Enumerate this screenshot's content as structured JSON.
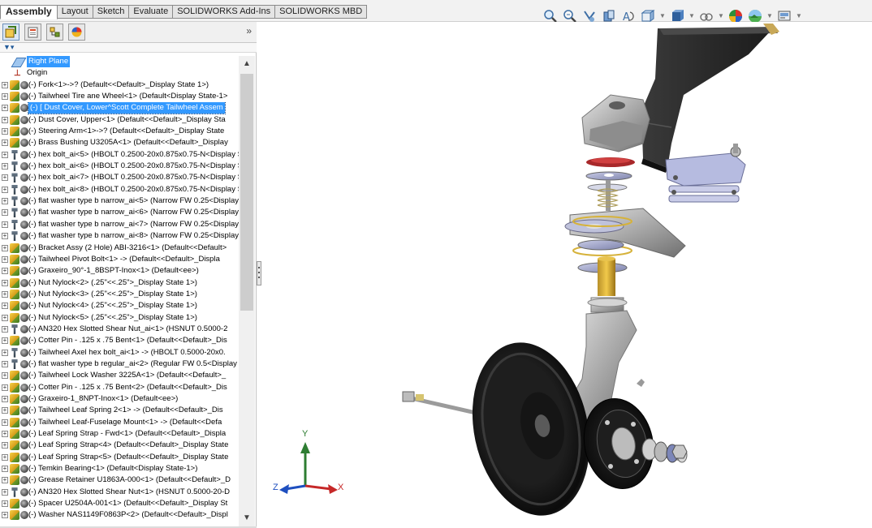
{
  "tabs": [
    {
      "label": "Assembly",
      "active": true
    },
    {
      "label": "Layout",
      "active": false
    },
    {
      "label": "Sketch",
      "active": false
    },
    {
      "label": "Evaluate",
      "active": false
    },
    {
      "label": "SOLIDWORKS Add-Ins",
      "active": false
    },
    {
      "label": "SOLIDWORKS MBD",
      "active": false
    }
  ],
  "panel": {
    "collapse_glyph": "»",
    "scroll_up_glyph": "^",
    "scroll_down_glyph": "v"
  },
  "tree": {
    "top_items": [
      {
        "label": "Right Plane",
        "icon": "plane-icon",
        "selected_style": true
      },
      {
        "label": "Origin",
        "icon": "origin-icon"
      }
    ],
    "items": [
      {
        "label": "(-) Fork<1>->? (Default<<Default>_Display State 1>)",
        "icon": "part-icon"
      },
      {
        "label": "(-) Tailwheel Tire ane Wheel<1> (Default<Display State-1>",
        "icon": "part-icon"
      },
      {
        "label": "(-) [ Dust Cover, Lower^Scott Complete Tailwheel Assem",
        "icon": "part-icon",
        "selected": true
      },
      {
        "label": "(-) Dust Cover, Upper<1> (Default<<Default>_Display Sta",
        "icon": "part-icon"
      },
      {
        "label": "(-) Steering Arm<1>->? (Default<<Default>_Display State",
        "icon": "part-icon"
      },
      {
        "label": "(-) Brass Bushing U3205A<1> (Default<<Default>_Display",
        "icon": "part-icon"
      },
      {
        "label": "(-) hex bolt_ai<5> (HBOLT 0.2500-20x0.875x0.75-N<Display S",
        "icon": "hardware-icon"
      },
      {
        "label": "(-) hex bolt_ai<6> (HBOLT 0.2500-20x0.875x0.75-N<Display S",
        "icon": "hardware-icon"
      },
      {
        "label": "(-) hex bolt_ai<7> (HBOLT 0.2500-20x0.875x0.75-N<Display S",
        "icon": "hardware-icon"
      },
      {
        "label": "(-) hex bolt_ai<8> (HBOLT 0.2500-20x0.875x0.75-N<Display S",
        "icon": "hardware-icon"
      },
      {
        "label": "(-) flat washer type b narrow_ai<5> (Narrow FW 0.25<Display",
        "icon": "hardware-icon"
      },
      {
        "label": "(-) flat washer type b narrow_ai<6> (Narrow FW 0.25<Display",
        "icon": "hardware-icon"
      },
      {
        "label": "(-) flat washer type b narrow_ai<7> (Narrow FW 0.25<Display",
        "icon": "hardware-icon"
      },
      {
        "label": "(-) flat washer type b narrow_ai<8> (Narrow FW 0.25<Display",
        "icon": "hardware-icon"
      },
      {
        "label": "(-) Bracket Assy (2 Hole) ABI-3216<1> (Default<<Default>",
        "icon": "part-icon"
      },
      {
        "label": "(-) Tailwheel Pivot Bolt<1> -> (Default<<Default>_Displa",
        "icon": "part-icon"
      },
      {
        "label": "(-) Graxeiro_90°-1_8BSPT-Inox<1> (Default<ee>)",
        "icon": "part-icon"
      },
      {
        "label": "(-) Nut Nylock<2> (.25\"<<.25\">_Display State 1>)",
        "icon": "part-icon"
      },
      {
        "label": "(-) Nut Nylock<3> (.25\"<<.25\">_Display State 1>)",
        "icon": "part-icon"
      },
      {
        "label": "(-) Nut Nylock<4> (.25\"<<.25\">_Display State 1>)",
        "icon": "part-icon"
      },
      {
        "label": "(-) Nut Nylock<5> (.25\"<<.25\">_Display State 1>)",
        "icon": "part-icon"
      },
      {
        "label": "(-) AN320 Hex Slotted Shear Nut_ai<1> (HSNUT 0.5000-2",
        "icon": "hardware-icon"
      },
      {
        "label": "(-) Cotter Pin - .125 x .75 Bent<1> (Default<<Default>_Dis",
        "icon": "part-icon"
      },
      {
        "label": "(-) Tailwheel Axel hex bolt_ai<1> -> (HBOLT 0.5000-20x0.",
        "icon": "hardware-icon"
      },
      {
        "label": "(-) flat washer type b regular_ai<2> (Regular FW 0.5<Display",
        "icon": "hardware-icon"
      },
      {
        "label": "(-) Tailwheel Lock Washer 3225A<1> (Default<<Default>_",
        "icon": "part-icon"
      },
      {
        "label": "(-) Cotter Pin - .125 x .75 Bent<2> (Default<<Default>_Dis",
        "icon": "part-icon"
      },
      {
        "label": "(-) Graxeiro-1_8NPT-Inox<1> (Default<ee>)",
        "icon": "part-icon"
      },
      {
        "label": "(-) Tailwheel Leaf Spring 2<1> -> (Default<<Default>_Dis",
        "icon": "part-icon"
      },
      {
        "label": "(-) Tailwheel Leaf-Fuselage Mount<1> -> (Default<<Defa",
        "icon": "part-icon"
      },
      {
        "label": "(-) Leaf Spring Strap - Fwd<1> (Default<<Default>_Displa",
        "icon": "part-icon"
      },
      {
        "label": "(-) Leaf Spring Strap<4> (Default<<Default>_Display State",
        "icon": "part-icon"
      },
      {
        "label": "(-) Leaf Spring Strap<5> (Default<<Default>_Display State",
        "icon": "part-icon"
      },
      {
        "label": "(-) Temkin Bearing<1> (Default<Display State-1>)",
        "icon": "part-icon"
      },
      {
        "label": "(-) Grease Retainer U1863A-000<1> (Default<<Default>_D",
        "icon": "part-icon"
      },
      {
        "label": "(-) AN320 Hex Slotted Shear Nut<1> (HSNUT 0.5000-20-D",
        "icon": "hardware-icon"
      },
      {
        "label": "(-) Spacer U2504A-001<1> (Default<<Default>_Display St",
        "icon": "part-icon"
      },
      {
        "label": "(-) Washer NAS1149F0863P<2> (Default<<Default>_Displ",
        "icon": "part-icon"
      }
    ]
  },
  "triad": {
    "x": "X",
    "y": "Y",
    "z": "Z"
  }
}
